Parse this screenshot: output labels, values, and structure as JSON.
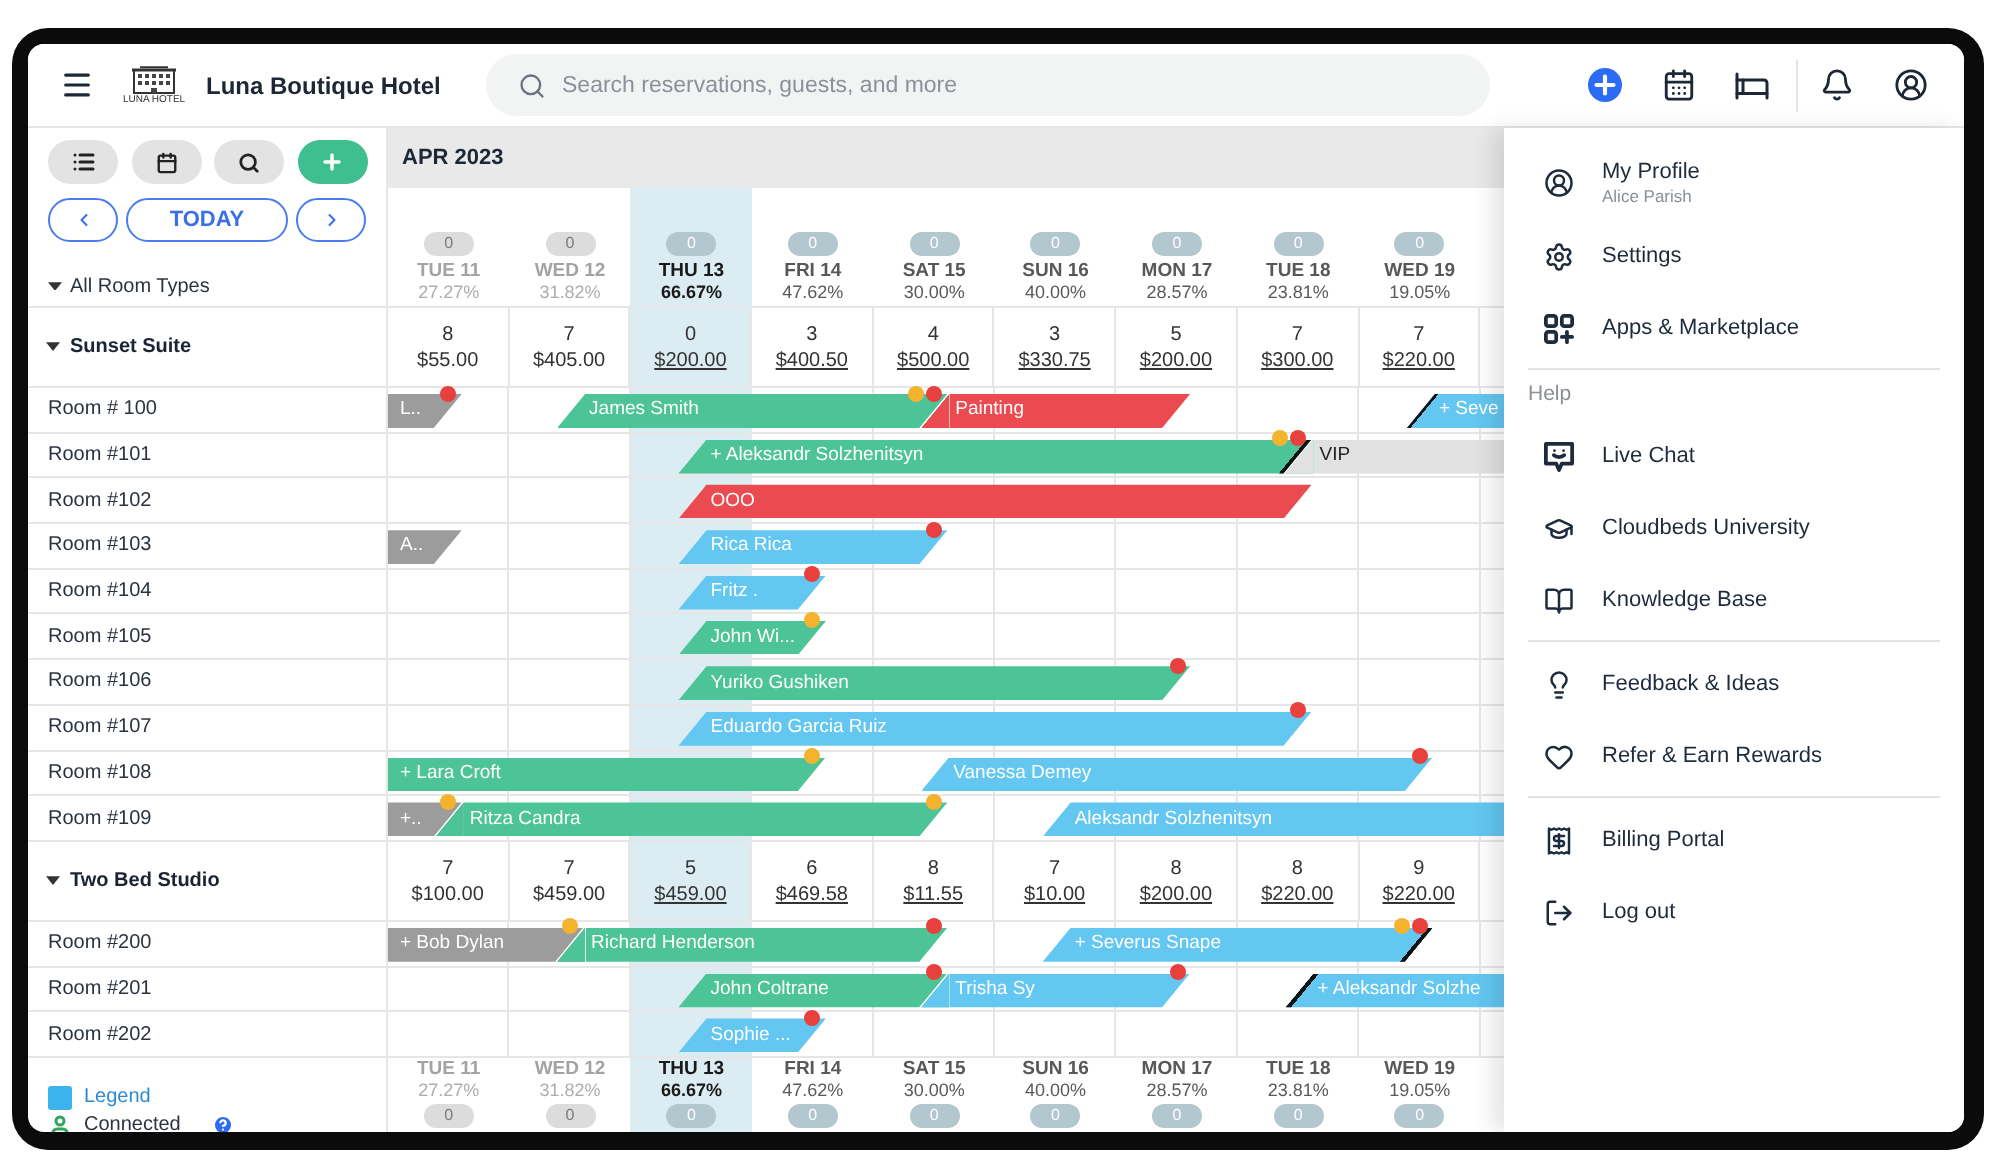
{
  "topbar": {
    "logo_text": "LUNA HOTEL",
    "hotel_name": "Luna Boutique Hotel",
    "search": {
      "placeholder": "Search reservations, guests, and more"
    }
  },
  "sidebar": {
    "today_button": "TODAY",
    "room_filter": "All Room Types",
    "legend": "Legend",
    "connection": "Connected"
  },
  "calendar": {
    "month": "APR 2023",
    "days": [
      {
        "badge": "0",
        "label": "TUE 11",
        "occupancy": "27.27%",
        "past": true,
        "today": false
      },
      {
        "badge": "0",
        "label": "WED 12",
        "occupancy": "31.82%",
        "past": true,
        "today": false
      },
      {
        "badge": "0",
        "label": "THU 13",
        "occupancy": "66.67%",
        "past": false,
        "today": true
      },
      {
        "badge": "0",
        "label": "FRI 14",
        "occupancy": "47.62%",
        "past": false,
        "today": false
      },
      {
        "badge": "0",
        "label": "SAT 15",
        "occupancy": "30.00%",
        "past": false,
        "today": false
      },
      {
        "badge": "0",
        "label": "SUN 16",
        "occupancy": "40.00%",
        "past": false,
        "today": false
      },
      {
        "badge": "0",
        "label": "MON 17",
        "occupancy": "28.57%",
        "past": false,
        "today": false
      },
      {
        "badge": "0",
        "label": "TUE 18",
        "occupancy": "23.81%",
        "past": false,
        "today": false
      },
      {
        "badge": "0",
        "label": "WED 19",
        "occupancy": "19.05%",
        "past": false,
        "today": false
      }
    ],
    "room_types": [
      {
        "name": "Sunset Suite",
        "expanded": true,
        "cells": [
          {
            "available": "8",
            "price": "$55.00"
          },
          {
            "available": "7",
            "price": "$405.00"
          },
          {
            "available": "0",
            "price": "$200.00"
          },
          {
            "available": "3",
            "price": "$400.50"
          },
          {
            "available": "4",
            "price": "$500.00"
          },
          {
            "available": "3",
            "price": "$330.75"
          },
          {
            "available": "5",
            "price": "$200.00"
          },
          {
            "available": "7",
            "price": "$300.00"
          },
          {
            "available": "7",
            "price": "$220.00"
          }
        ],
        "rooms": [
          {
            "name": "Room # 100",
            "bookings": [
              {
                "label": "L..",
                "color": "#9c9c9c",
                "dots": [
                  {
                    "color": "#e8403d"
                  }
                ],
                "split": false
              },
              {
                "label": "James Smith",
                "color": "#4cc497",
                "dots": [
                  {
                    "color": "#f4b32f"
                  },
                  {
                    "color": "#e8403d"
                  }
                ],
                "split": false
              },
              {
                "label": "Painting",
                "color": "#ec4a51",
                "split": false
              },
              {
                "label": "+ Seve",
                "color": "#63c7f1",
                "split": true
              }
            ]
          },
          {
            "name": "Room #101",
            "bookings": [
              {
                "label": "+ Aleksandr Solzhenitsyn",
                "color": "#4cc497",
                "dots": [
                  {
                    "color": "#f4b32f"
                  },
                  {
                    "color": "#e8403d"
                  }
                ],
                "split": true
              },
              {
                "label": "VIP",
                "color": "#e1e1e1",
                "split": false
              }
            ]
          },
          {
            "name": "Room #102",
            "bookings": [
              {
                "label": "OOO",
                "color": "#ec4a51",
                "split": false
              }
            ]
          },
          {
            "name": "Room #103",
            "bookings": [
              {
                "label": "A..",
                "color": "#9c9c9c",
                "split": false
              },
              {
                "label": "Rica Rica",
                "color": "#63c7f1",
                "dots": [
                  {
                    "color": "#e8403d"
                  }
                ],
                "split": false
              }
            ]
          },
          {
            "name": "Room #104",
            "bookings": [
              {
                "label": "Fritz .",
                "color": "#63c7f1",
                "dots": [
                  {
                    "color": "#e8403d"
                  }
                ],
                "split": false
              }
            ]
          },
          {
            "name": "Room #105",
            "bookings": [
              {
                "label": "John Wi...",
                "color": "#4cc497",
                "dots": [
                  {
                    "color": "#f4b32f"
                  }
                ],
                "split": false
              }
            ]
          },
          {
            "name": "Room #106",
            "bookings": [
              {
                "label": "Yuriko Gushiken",
                "color": "#4cc497",
                "dots": [
                  {
                    "color": "#e8403d"
                  }
                ],
                "split": false
              }
            ]
          },
          {
            "name": "Room #107",
            "bookings": [
              {
                "label": "Eduardo Garcia Ruiz",
                "color": "#63c7f1",
                "dots": [
                  {
                    "color": "#e8403d"
                  }
                ],
                "split": false
              }
            ]
          },
          {
            "name": "Room #108",
            "bookings": [
              {
                "label": "+ Lara Croft",
                "color": "#4cc497",
                "dots": [
                  {
                    "color": "#f4b32f"
                  }
                ],
                "split": false
              },
              {
                "label": "Vanessa Demey",
                "color": "#63c7f1",
                "dots": [
                  {
                    "color": "#e8403d"
                  }
                ],
                "split": false
              }
            ]
          },
          {
            "name": "Room #109",
            "bookings": [
              {
                "label": "+..",
                "color": "#9c9c9c",
                "dots": [
                  {
                    "color": "#f4b32f"
                  }
                ],
                "split": false
              },
              {
                "label": "Ritza Candra",
                "color": "#4cc497",
                "dots": [
                  {
                    "color": "#f4b32f"
                  }
                ],
                "split": false
              },
              {
                "label": "Aleksandr Solzhenitsyn",
                "color": "#63c7f1",
                "split": false
              }
            ]
          }
        ]
      },
      {
        "name": "Two Bed Studio",
        "expanded": true,
        "cells": [
          {
            "available": "7",
            "price": "$100.00"
          },
          {
            "available": "7",
            "price": "$459.00"
          },
          {
            "available": "5",
            "price": "$459.00"
          },
          {
            "available": "6",
            "price": "$469.58"
          },
          {
            "available": "8",
            "price": "$11.55"
          },
          {
            "available": "7",
            "price": "$10.00"
          },
          {
            "available": "8",
            "price": "$200.00"
          },
          {
            "available": "8",
            "price": "$220.00"
          },
          {
            "available": "9",
            "price": "$220.00"
          }
        ],
        "rooms": [
          {
            "name": "Room #200",
            "bookings": [
              {
                "label": "+ Bob Dylan",
                "color": "#9c9c9c",
                "dots": [
                  {
                    "color": "#f4b32f"
                  }
                ],
                "split": false
              },
              {
                "label": "Richard Henderson",
                "color": "#4cc497",
                "dots": [
                  {
                    "color": "#e8403d"
                  }
                ],
                "split": false
              },
              {
                "label": "+ Severus Snape",
                "color": "#63c7f1",
                "dots": [
                  {
                    "color": "#f4b32f"
                  },
                  {
                    "color": "#e8403d"
                  }
                ],
                "split": true
              }
            ]
          },
          {
            "name": "Room #201",
            "bookings": [
              {
                "label": "John Coltrane",
                "color": "#4cc497",
                "dots": [
                  {
                    "color": "#e8403d"
                  }
                ],
                "split": false
              },
              {
                "label": "Trisha Sy",
                "color": "#63c7f1",
                "dots": [
                  {
                    "color": "#e8403d"
                  }
                ],
                "split": false
              },
              {
                "label": "+ Aleksandr Solzhe",
                "color": "#63c7f1",
                "split": true
              }
            ]
          },
          {
            "name": "Room #202",
            "bookings": [
              {
                "label": "Sophie ...",
                "color": "#63c7f1",
                "dots": [
                  {
                    "color": "#e8403d"
                  }
                ],
                "split": false
              }
            ]
          }
        ]
      }
    ],
    "footer_days": [
      {
        "badge": "0",
        "label": "TUE 11",
        "occupancy": "27.27%",
        "past": true,
        "today": false
      },
      {
        "badge": "0",
        "label": "WED 12",
        "occupancy": "31.82%",
        "past": true,
        "today": false
      },
      {
        "badge": "0",
        "label": "THU 13",
        "occupancy": "66.67%",
        "past": false,
        "today": true
      },
      {
        "badge": "0",
        "label": "FRI 14",
        "occupancy": "47.62%",
        "past": false,
        "today": false
      },
      {
        "badge": "0",
        "label": "SAT 15",
        "occupancy": "30.00%",
        "past": false,
        "today": false
      },
      {
        "badge": "0",
        "label": "SUN 16",
        "occupancy": "40.00%",
        "past": false,
        "today": false
      },
      {
        "badge": "0",
        "label": "MON 17",
        "occupancy": "28.57%",
        "past": false,
        "today": false
      },
      {
        "badge": "0",
        "label": "TUE 18",
        "occupancy": "23.81%",
        "past": false,
        "today": false
      },
      {
        "badge": "0",
        "label": "WED 19",
        "occupancy": "19.05%",
        "past": false,
        "today": false
      }
    ]
  },
  "menu": {
    "groups": [
      {
        "items": [
          {
            "label": "My Profile",
            "subtitle": "Alice Parish"
          },
          {
            "label": "Settings"
          },
          {
            "label": "Apps & Marketplace"
          }
        ]
      },
      {
        "title": "Help",
        "items": [
          {
            "label": "Live Chat"
          },
          {
            "label": "Cloudbeds University"
          },
          {
            "label": "Knowledge Base"
          }
        ]
      },
      {
        "items": [
          {
            "label": "Feedback & Ideas"
          },
          {
            "label": "Refer & Earn Rewards"
          }
        ]
      },
      {
        "items": [
          {
            "label": "Billing Portal"
          },
          {
            "label": "Log out"
          }
        ]
      }
    ]
  }
}
